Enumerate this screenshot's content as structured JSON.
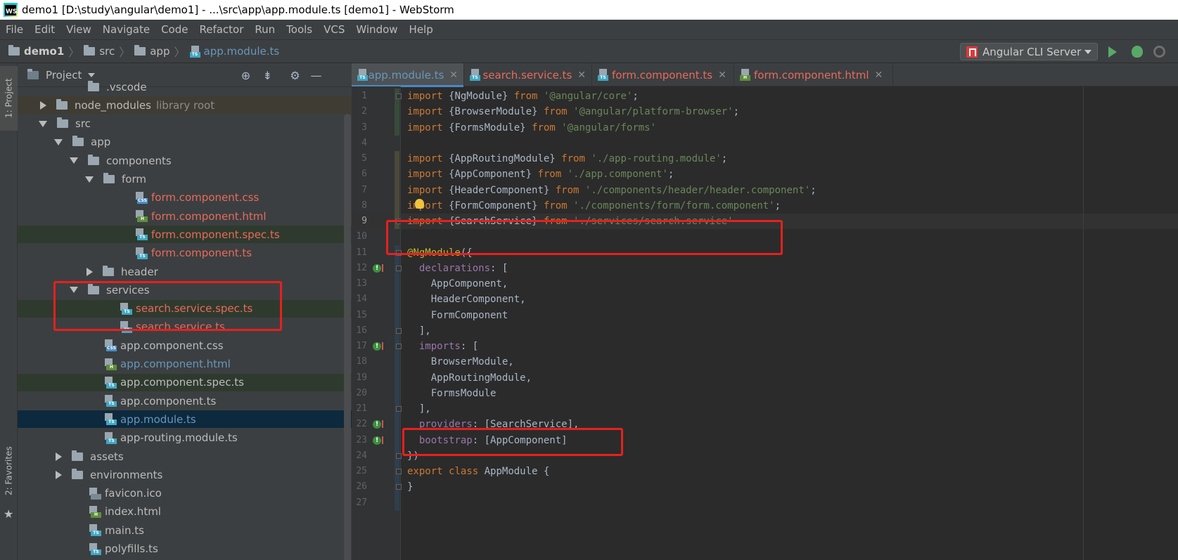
{
  "window": {
    "title": "demo1 [D:\\study\\angular\\demo1] - ...\\src\\app\\app.module.ts [demo1] - WebStorm",
    "logo_text": "WS"
  },
  "menu": [
    "File",
    "Edit",
    "View",
    "Navigate",
    "Code",
    "Refactor",
    "Run",
    "Tools",
    "VCS",
    "Window",
    "Help"
  ],
  "breadcrumb": {
    "root": "demo1",
    "items": [
      "src",
      "app"
    ],
    "file": "app.module.ts"
  },
  "run_config": {
    "label": "Angular CLI Server"
  },
  "stripe": {
    "project_tab": "1: Project",
    "favorites_tab": "2: Favorites"
  },
  "project_panel": {
    "title": "Project",
    "tree": [
      {
        "label": ".vscode",
        "kind": "folder",
        "state": "none",
        "color": "default"
      },
      {
        "label": "node_modules",
        "hint": "library root",
        "kind": "folder",
        "state": "closed",
        "color": "default"
      },
      {
        "label": "src",
        "kind": "folder",
        "state": "open",
        "color": "default"
      },
      {
        "label": "app",
        "kind": "folder",
        "state": "open",
        "color": "default"
      },
      {
        "label": "components",
        "kind": "folder",
        "state": "open",
        "color": "default"
      },
      {
        "label": "form",
        "kind": "folder",
        "state": "open",
        "color": "default"
      },
      {
        "label": "form.component.css",
        "kind": "css",
        "color": "red"
      },
      {
        "label": "form.component.html",
        "kind": "html",
        "color": "red"
      },
      {
        "label": "form.component.spec.ts",
        "kind": "ts",
        "color": "red"
      },
      {
        "label": "form.component.ts",
        "kind": "ts",
        "color": "red"
      },
      {
        "label": "header",
        "kind": "folder",
        "state": "closed",
        "color": "default"
      },
      {
        "label": "services",
        "kind": "folder",
        "state": "open",
        "color": "default"
      },
      {
        "label": "search.service.spec.ts",
        "kind": "ts",
        "color": "red"
      },
      {
        "label": "search.service.ts",
        "kind": "ts",
        "color": "red"
      },
      {
        "label": "app.component.css",
        "kind": "css",
        "color": "default"
      },
      {
        "label": "app.component.html",
        "kind": "html",
        "color": "modified"
      },
      {
        "label": "app.component.spec.ts",
        "kind": "ts",
        "color": "default"
      },
      {
        "label": "app.component.ts",
        "kind": "ts",
        "color": "default"
      },
      {
        "label": "app.module.ts",
        "kind": "ts",
        "color": "modified"
      },
      {
        "label": "app-routing.module.ts",
        "kind": "ts",
        "color": "default"
      },
      {
        "label": "assets",
        "kind": "folder",
        "state": "closed",
        "color": "default"
      },
      {
        "label": "environments",
        "kind": "folder",
        "state": "closed",
        "color": "default"
      },
      {
        "label": "favicon.ico",
        "kind": "ico",
        "color": "default"
      },
      {
        "label": "index.html",
        "kind": "html",
        "color": "default"
      },
      {
        "label": "main.ts",
        "kind": "ts",
        "color": "default"
      },
      {
        "label": "polyfills.ts",
        "kind": "ts",
        "color": "default"
      }
    ]
  },
  "editor": {
    "tabs": [
      {
        "label": "app.module.ts",
        "active": true,
        "icon": "ts"
      },
      {
        "label": "search.service.ts",
        "active": false,
        "icon": "ts"
      },
      {
        "label": "form.component.ts",
        "active": false,
        "icon": "ts"
      },
      {
        "label": "form.component.html",
        "active": false,
        "icon": "html"
      }
    ],
    "lines": [
      "import {NgModule} from '@angular/core';",
      "import {BrowserModule} from '@angular/platform-browser';",
      "import {FormsModule} from '@angular/forms'",
      "",
      "import {AppRoutingModule} from './app-routing.module';",
      "import {AppComponent} from './app.component';",
      "import {HeaderComponent} from './components/header/header.component';",
      "import {FormComponent} from './components/form/form.component';",
      "import {SearchService} from './services/search.service'",
      "",
      "@NgModule({",
      "  declarations: [",
      "    AppComponent,",
      "    HeaderComponent,",
      "    FormComponent",
      "  ],",
      "  imports: [",
      "    BrowserModule,",
      "    AppRoutingModule,",
      "    FormsModule",
      "  ],",
      "  providers: [SearchService],",
      "  bootstrap: [AppComponent]",
      "})",
      "export class AppModule {",
      "}",
      ""
    ]
  },
  "colors": {
    "keyword": "#cc7832",
    "string": "#6a8759",
    "identifier": "#a9b7c6",
    "annotation": "#bbb529",
    "property": "#9876aa",
    "highlight_box": "#e8201e",
    "unversioned": "#e96a5a",
    "modified": "#6897bb"
  }
}
